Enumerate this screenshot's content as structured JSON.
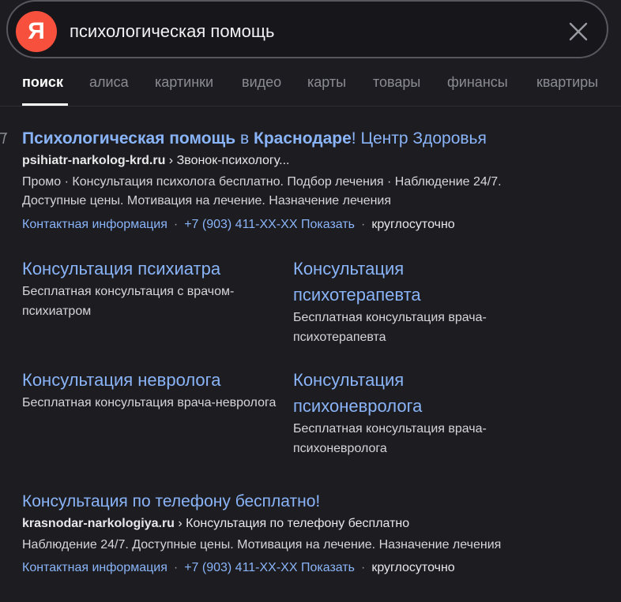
{
  "search": {
    "logo_letter": "Я",
    "query": "психологическая помощь"
  },
  "tabs": [
    {
      "label": "поиск",
      "active": true
    },
    {
      "label": "алиса"
    },
    {
      "label": "картинки"
    },
    {
      "label": "видео"
    },
    {
      "label": "карты"
    },
    {
      "label": "товары"
    },
    {
      "label": "финансы"
    },
    {
      "label": "квартиры"
    }
  ],
  "result1": {
    "title_bold1": "Психологическая помощь",
    "title_in": " в ",
    "title_bold2": "Краснодаре",
    "title_rest": "! Центр Здоровья",
    "domain": "psihiatr-narkolog-krd.ru",
    "breadcrumb": " › Звонок-психологу...",
    "desc_line1": "Промо · Консультация психолога бесплатно. Подбор лечения · Наблюдение 24/7.",
    "desc_line2": "Доступные цены. Мотивация на лечение. Назначение лечения",
    "contact_link": "Контактная информация",
    "phone_link": "+7 (903) 411-XX-XX Показать",
    "hours": "круглосуточно",
    "sitelinks": [
      {
        "title": "Консультация психиатра",
        "desc": "Бесплатная консультация с врачом-психиатром"
      },
      {
        "title": "Консультация психотерапевта",
        "desc": "Бесплатная консультация врача-психотерапевта"
      },
      {
        "title": "Консультация невролога",
        "desc": "Бесплатная консультация врача-невролога"
      },
      {
        "title": "Консультация психоневролога",
        "desc": "Бесплатная консультация врача-психоневролога"
      }
    ]
  },
  "result2": {
    "title": "Консультация по телефону бесплатно!",
    "domain": "krasnodar-narkologiya.ru",
    "breadcrumb": " › Консультация по телефону бесплатно",
    "desc": "Наблюдение 24/7. Доступные цены. Мотивация на лечение. Назначение лечения",
    "contact_link": "Контактная информация",
    "phone_link": "+7 (903) 411-XX-XX Показать",
    "hours": "круглосуточно"
  },
  "colors": {
    "background": "#1c1c21",
    "link": "#8ab4f8",
    "logo": "#f7503c"
  }
}
